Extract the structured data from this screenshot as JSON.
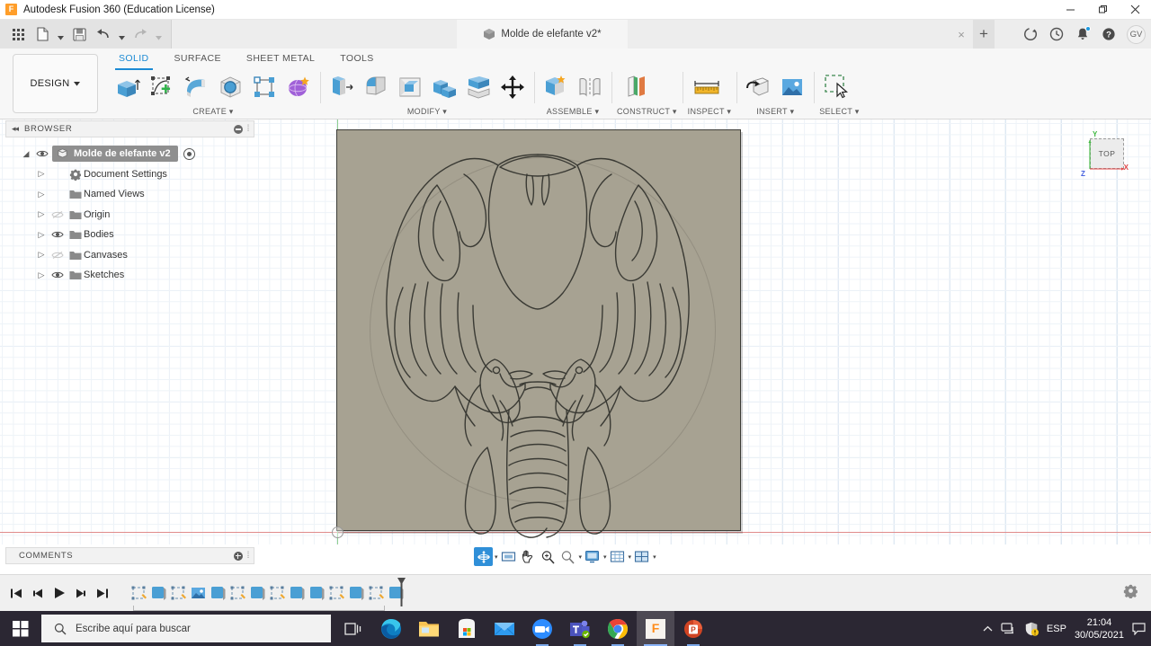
{
  "window": {
    "title": "Autodesk Fusion 360 (Education License)",
    "logo_letter": "F",
    "minimize_icon": "minimize-icon",
    "restore_icon": "restore-icon",
    "close_icon": "close-icon"
  },
  "quick_access": {
    "items": [
      {
        "name": "app-grid-icon",
        "label": ""
      },
      {
        "name": "new-file-icon",
        "label": ""
      },
      {
        "name": "save-icon",
        "label": ""
      },
      {
        "name": "undo-icon",
        "label": ""
      },
      {
        "name": "redo-icon",
        "label": ""
      }
    ]
  },
  "document_tab": {
    "title": "Molde de elefante v2*",
    "cube_icon": "cube-icon",
    "close_label": "×",
    "new_tab_label": "+"
  },
  "top_right": {
    "items": [
      {
        "name": "job-status-icon"
      },
      {
        "name": "recent-activity-icon"
      },
      {
        "name": "notifications-bell-icon"
      },
      {
        "name": "help-icon"
      }
    ],
    "avatar_initials": "GV"
  },
  "ribbon": {
    "design_dropdown": "DESIGN",
    "tabs": [
      {
        "label": "SOLID",
        "active": true
      },
      {
        "label": "SURFACE",
        "active": false
      },
      {
        "label": "SHEET METAL",
        "active": false
      },
      {
        "label": "TOOLS",
        "active": false
      }
    ],
    "panels": [
      {
        "label": "CREATE",
        "tools": [
          {
            "name": "extrude-icon"
          },
          {
            "name": "create-sketch-icon"
          },
          {
            "name": "revolve-icon"
          },
          {
            "name": "sphere-icon"
          },
          {
            "name": "pattern-icon"
          },
          {
            "name": "form-icon"
          }
        ]
      },
      {
        "label": "MODIFY",
        "tools": [
          {
            "name": "press-pull-icon"
          },
          {
            "name": "fillet-icon"
          },
          {
            "name": "shell-icon"
          },
          {
            "name": "combine-icon"
          },
          {
            "name": "split-body-icon"
          },
          {
            "name": "move-copy-icon"
          }
        ]
      },
      {
        "label": "ASSEMBLE",
        "tools": [
          {
            "name": "new-component-icon"
          },
          {
            "name": "joint-icon"
          }
        ]
      },
      {
        "label": "CONSTRUCT",
        "tools": [
          {
            "name": "offset-plane-icon"
          }
        ]
      },
      {
        "label": "INSPECT",
        "tools": [
          {
            "name": "measure-icon"
          }
        ]
      },
      {
        "label": "INSERT",
        "tools": [
          {
            "name": "insert-derive-icon"
          },
          {
            "name": "insert-canvas-icon"
          }
        ]
      },
      {
        "label": "SELECT",
        "tools": [
          {
            "name": "window-selection-icon"
          }
        ]
      }
    ]
  },
  "browser": {
    "header": "BROWSER",
    "collapse_icon": "collapse-left-icon",
    "minus_icon": "circle-minus-icon",
    "grip_icon": "panel-grip-icon",
    "root": {
      "label": "Molde de elefante v2",
      "visible": true,
      "expanded": true,
      "cube_icon": "component-cube-icon",
      "activate_icon": "activate-component-icon"
    },
    "items": [
      {
        "label": "Document Settings",
        "icon": "gear-icon",
        "has_eye": false,
        "visible": false
      },
      {
        "label": "Named Views",
        "icon": "folder-icon",
        "has_eye": false,
        "visible": false
      },
      {
        "label": "Origin",
        "icon": "folder-icon",
        "has_eye": true,
        "visible": false
      },
      {
        "label": "Bodies",
        "icon": "folder-icon",
        "has_eye": true,
        "visible": true
      },
      {
        "label": "Canvases",
        "icon": "folder-icon",
        "has_eye": true,
        "visible": false
      },
      {
        "label": "Sketches",
        "icon": "folder-icon",
        "has_eye": true,
        "visible": true
      }
    ]
  },
  "canvas": {
    "viewcube": {
      "face_label": "TOP",
      "axis_x": "X",
      "axis_y": "Y",
      "axis_z": "Z",
      "color_x": "#e04545",
      "color_y": "#3eb83e",
      "color_z": "#4a64e0"
    },
    "model": {
      "name": "elephant-mold-plate",
      "plate_color": "#a7a292",
      "sketch_color": "#3a3a34"
    },
    "origin_marker": "origin-point-marker",
    "grid_color": "#dce7f2",
    "axis_x_color": "#e08b8b",
    "axis_y_color": "#8fcf8f"
  },
  "comments": {
    "header": "COMMENTS",
    "plus_icon": "circle-plus-icon",
    "grip_icon": "panel-grip-icon"
  },
  "navigation_bar": {
    "items": [
      {
        "name": "orbit-icon",
        "selected": true,
        "has_caret": true
      },
      {
        "name": "fit-icon",
        "selected": false,
        "has_caret": false
      },
      {
        "name": "pan-icon",
        "selected": false,
        "has_caret": false
      },
      {
        "name": "zoom-icon",
        "selected": false,
        "has_caret": false
      },
      {
        "name": "zoom-window-icon",
        "selected": false,
        "has_caret": true
      },
      {
        "name": "display-settings-icon",
        "selected": false,
        "has_caret": true
      },
      {
        "name": "grid-snaps-icon",
        "selected": false,
        "has_caret": true
      },
      {
        "name": "viewports-icon",
        "selected": false,
        "has_caret": true
      }
    ]
  },
  "timeline": {
    "playback": [
      {
        "name": "go-to-beginning-icon"
      },
      {
        "name": "step-back-icon"
      },
      {
        "name": "play-icon"
      },
      {
        "name": "step-forward-icon"
      },
      {
        "name": "go-to-end-icon"
      }
    ],
    "features": [
      {
        "name": "timeline-sketch-feature",
        "type": "sketch"
      },
      {
        "name": "timeline-extrude-feature",
        "type": "extrude"
      },
      {
        "name": "timeline-sketch-feature",
        "type": "sketch"
      },
      {
        "name": "timeline-canvas-feature",
        "type": "canvas"
      },
      {
        "name": "timeline-extrude-feature",
        "type": "extrude"
      },
      {
        "name": "timeline-sketch-feature",
        "type": "sketch"
      },
      {
        "name": "timeline-extrude-feature",
        "type": "extrude"
      },
      {
        "name": "timeline-sketch-feature",
        "type": "sketch"
      },
      {
        "name": "timeline-extrude-feature",
        "type": "extrude"
      },
      {
        "name": "timeline-extrude-feature",
        "type": "extrude"
      },
      {
        "name": "timeline-sketch-feature",
        "type": "sketch"
      },
      {
        "name": "timeline-extrude-feature",
        "type": "extrude"
      },
      {
        "name": "timeline-sketch-feature",
        "type": "sketch"
      },
      {
        "name": "timeline-extrude-feature",
        "type": "extrude"
      }
    ],
    "settings_icon": "timeline-settings-gear-icon"
  },
  "taskbar": {
    "start_icon": "windows-start-icon",
    "search_placeholder": "Escribe aquí para buscar",
    "search_icon": "search-icon",
    "apps": [
      {
        "name": "task-view-icon",
        "running": false,
        "active": false
      },
      {
        "name": "microsoft-edge-icon",
        "running": false,
        "active": false
      },
      {
        "name": "file-explorer-icon",
        "running": false,
        "active": false
      },
      {
        "name": "microsoft-store-icon",
        "running": false,
        "active": false
      },
      {
        "name": "mail-icon",
        "running": false,
        "active": false
      },
      {
        "name": "zoom-app-icon",
        "running": true,
        "active": false
      },
      {
        "name": "microsoft-teams-icon",
        "running": true,
        "active": false
      },
      {
        "name": "google-chrome-icon",
        "running": true,
        "active": false
      },
      {
        "name": "fusion-360-icon",
        "running": true,
        "active": true
      },
      {
        "name": "powerpoint-icon",
        "running": true,
        "active": false
      }
    ],
    "tray": {
      "chevron_icon": "show-hidden-icons-icon",
      "network_icon": "network-icon",
      "security_icon": "windows-security-warning-icon",
      "language": "ESP",
      "time": "21:04",
      "date": "30/05/2021",
      "action_center_icon": "action-center-icon"
    }
  }
}
